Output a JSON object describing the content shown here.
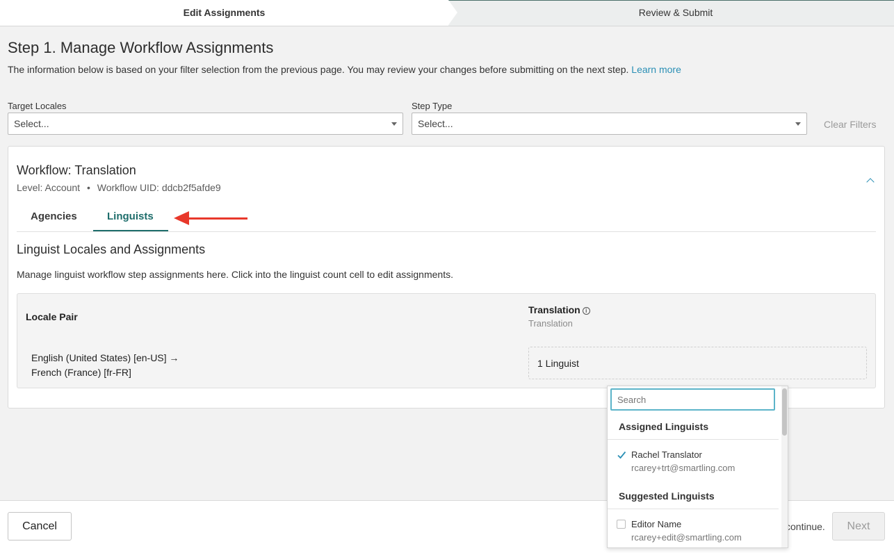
{
  "steps": [
    {
      "label": "Edit Assignments",
      "active": true
    },
    {
      "label": "Review & Submit",
      "active": false
    }
  ],
  "page": {
    "title": "Step 1. Manage Workflow Assignments",
    "description": "The information below is based on your filter selection from the previous page. You may review your changes before submitting on the next step.",
    "learn_more": "Learn more"
  },
  "filters": {
    "target_locales": {
      "label": "Target Locales",
      "placeholder": "Select..."
    },
    "step_type": {
      "label": "Step Type",
      "placeholder": "Select..."
    },
    "clear": "Clear Filters"
  },
  "workflow": {
    "title": "Workflow: Translation",
    "level": "Level: Account",
    "separator": "•",
    "uid": "Workflow UID: ddcb2f5afde9",
    "tabs": [
      {
        "label": "Agencies",
        "active": false
      },
      {
        "label": "Linguists",
        "active": true
      }
    ],
    "section_title": "Linguist Locales and Assignments",
    "section_desc": "Manage linguist workflow step assignments here. Click into the linguist count cell to edit assignments.",
    "table": {
      "col_locale": "Locale Pair",
      "col_step": "Translation",
      "col_step_sub": "Translation",
      "info_icon": "i",
      "rows": [
        {
          "source": "English (United States) [en-US] →",
          "target": "French (France) [fr-FR]",
          "count": "1 Linguist"
        }
      ]
    }
  },
  "dropdown": {
    "search_placeholder": "Search",
    "assigned_header": "Assigned Linguists",
    "assigned": [
      {
        "name": "Rachel Translator",
        "email": "rcarey+trt@smartling.com",
        "checked": true
      }
    ],
    "suggested_header": "Suggested Linguists",
    "suggested": [
      {
        "name": "Editor Name",
        "email": "rcarey+edit@smartling.com",
        "checked": false
      }
    ]
  },
  "footer": {
    "cancel": "Cancel",
    "continue_text": "continue.",
    "next": "Next"
  },
  "colors": {
    "accent": "#1e6d6b",
    "link": "#2a8fb5",
    "annotation_arrow": "#e8382b"
  }
}
